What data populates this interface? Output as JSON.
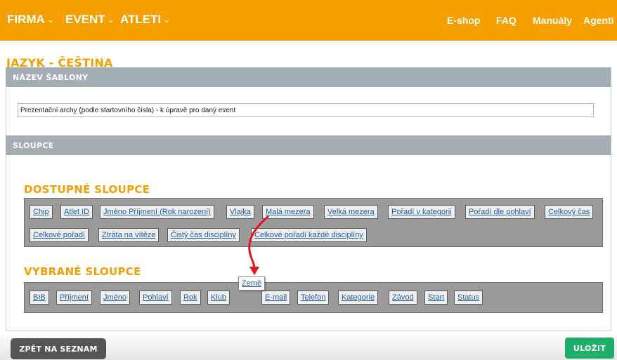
{
  "nav": {
    "left": [
      {
        "label": "FIRMA",
        "chevron": "⌄"
      },
      {
        "label": "EVENT",
        "chevron": "⌄"
      },
      {
        "label": "ATLETI",
        "chevron": "⌄"
      }
    ],
    "right": [
      "E-shop",
      "FAQ",
      "Manuály",
      "Agenti"
    ]
  },
  "page": {
    "heading": "JAZYK - ČEŠTINA",
    "template_section": "NÁZEV ŠABLONY",
    "template_name": "Prezentační archy (podle startovního čísla) - k úpravě pro daný event",
    "columns_section": "SLOUPCE",
    "available_heading": "DOSTUPNÉ SLOUPCE",
    "selected_heading": "VYBRANÉ SLOUPCE"
  },
  "available_columns": [
    "Chip",
    "Atlet ID",
    "Jméno Příjmení (Rok narození)",
    "Vlajka",
    "Malá mezera",
    "Velká mezera",
    "Pořadí v kategorii",
    "Pořadí dle pohlaví",
    "Celkový čas",
    "Celkové pořadí",
    "Ztráta na vítěze",
    "Čistý čas disciplíny",
    "Celkové pořadí každé disciplíny"
  ],
  "selected_columns": [
    "BIB",
    "Příjmení",
    "Jméno",
    "Pohlaví",
    "Rok",
    "Klub",
    "E-mail",
    "Telefon",
    "Kategorie",
    "Závod",
    "Start",
    "Status"
  ],
  "dragging_column": "Země",
  "buttons": {
    "back": "ZPĚT NA SEZNAM",
    "save": "ULOŽIT"
  },
  "colors": {
    "accent": "#f5a000",
    "section_bar": "#a4adb2",
    "save": "#1fae6a",
    "back": "#555555",
    "drag_arrow": "#e8141c"
  }
}
